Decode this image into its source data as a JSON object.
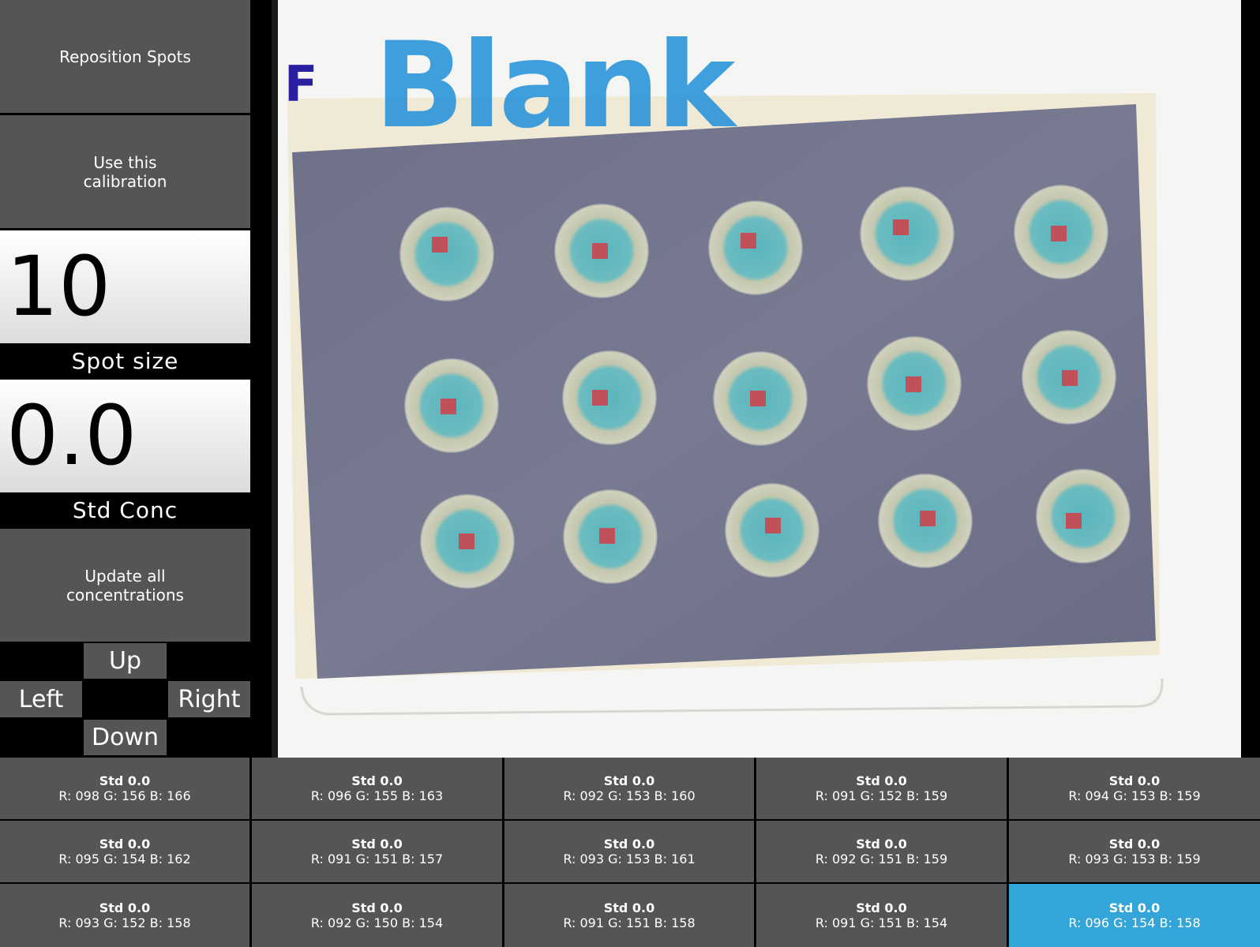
{
  "sidebar": {
    "reposition_label": "Reposition Spots",
    "calibration_label": "Use this\ncalibration",
    "spot_size_value": "10",
    "spot_size_label": "Spot size",
    "std_conc_value": "0.0",
    "std_conc_label": "Std Conc",
    "update_label": "Update all\nconcentrations",
    "dpad": {
      "up": "Up",
      "left": "Left",
      "right": "Right",
      "down": "Down"
    }
  },
  "photo": {
    "handwriting": "F Blank",
    "colors": {
      "paper": "#6f7089",
      "spot_ring": "#c4c7ae",
      "spot_center": "#5ab5bd",
      "marker": "#c0505a",
      "ink": "#1e8fd8"
    }
  },
  "readings": [
    [
      {
        "title": "Std 0.0",
        "r": "R: 098",
        "g": "G: 156",
        "b": "B: 166"
      },
      {
        "title": "Std 0.0",
        "r": "R: 096",
        "g": "G: 155",
        "b": "B: 163"
      },
      {
        "title": "Std 0.0",
        "r": "R: 092",
        "g": "G: 153",
        "b": "B: 160"
      },
      {
        "title": "Std 0.0",
        "r": "R: 091",
        "g": "G: 152",
        "b": "B: 159"
      },
      {
        "title": "Std 0.0",
        "r": "R: 094",
        "g": "G: 153",
        "b": "B: 159"
      }
    ],
    [
      {
        "title": "Std 0.0",
        "r": "R: 095",
        "g": "G: 154",
        "b": "B: 162"
      },
      {
        "title": "Std 0.0",
        "r": "R: 091",
        "g": "G: 151",
        "b": "B: 157"
      },
      {
        "title": "Std 0.0",
        "r": "R: 093",
        "g": "G: 153",
        "b": "B: 161"
      },
      {
        "title": "Std 0.0",
        "r": "R: 092",
        "g": "G: 151",
        "b": "B: 159"
      },
      {
        "title": "Std 0.0",
        "r": "R: 093",
        "g": "G: 153",
        "b": "B: 159"
      }
    ],
    [
      {
        "title": "Std 0.0",
        "r": "R: 093",
        "g": "G: 152",
        "b": "B: 158"
      },
      {
        "title": "Std 0.0",
        "r": "R: 092",
        "g": "G: 150",
        "b": "B: 154"
      },
      {
        "title": "Std 0.0",
        "r": "R: 091",
        "g": "G: 151",
        "b": "B: 158"
      },
      {
        "title": "Std 0.0",
        "r": "R: 091",
        "g": "G: 151",
        "b": "B: 154"
      },
      {
        "title": "Std 0.0",
        "r": "R: 096",
        "g": "G: 154",
        "b": "B: 158",
        "selected": true
      }
    ]
  ],
  "colors": {
    "button": "#555555",
    "selected": "#33a5d8",
    "background": "#000000"
  }
}
